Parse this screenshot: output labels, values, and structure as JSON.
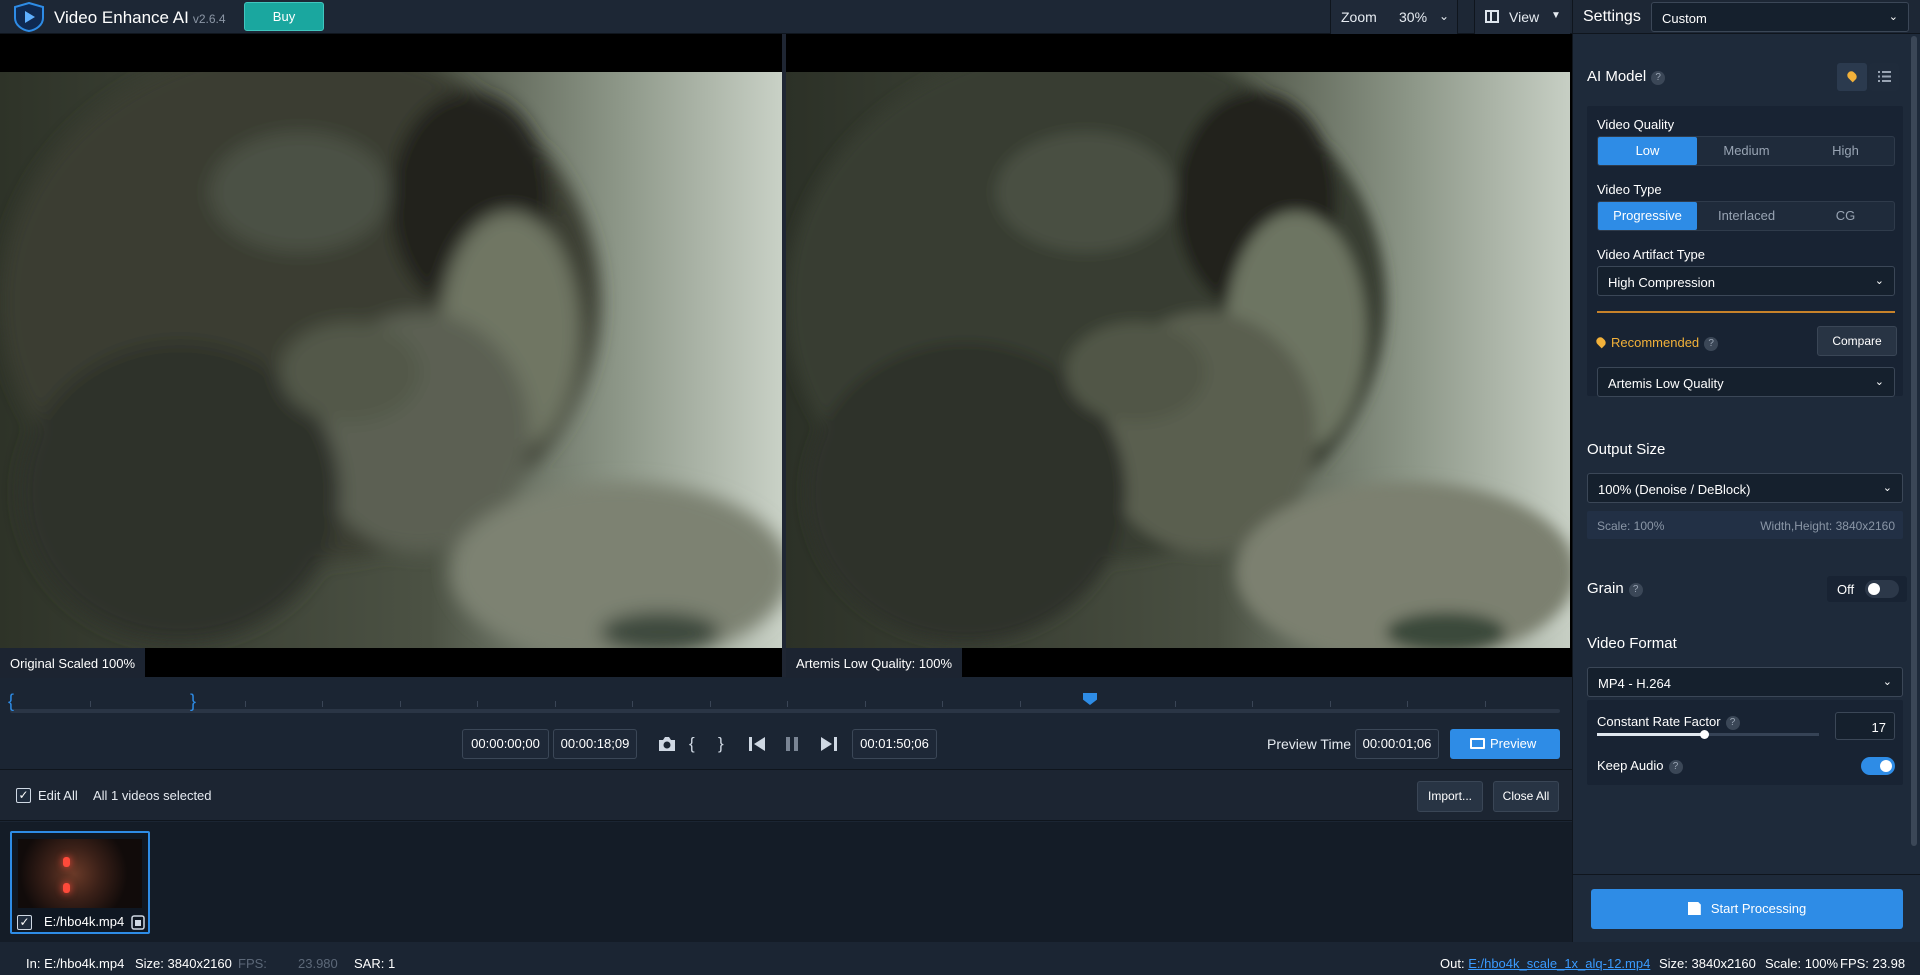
{
  "app": {
    "title": "Video Enhance AI",
    "version": "v2.6.4",
    "buy_label": "Buy"
  },
  "toolbar": {
    "zoom_label": "Zoom",
    "zoom_value": "30%",
    "view_label": "View"
  },
  "viewer": {
    "left_caption": "Original Scaled 100%",
    "right_caption": "Artemis Low Quality: 100%"
  },
  "timeline": {
    "start_time": "00:00:00;00",
    "selection_duration": "00:00:18;09",
    "total_time": "00:01:50;06",
    "preview_time_label": "Preview Time",
    "preview_time": "00:00:01;06",
    "preview_button": "Preview"
  },
  "filebar": {
    "edit_all_label": "Edit All",
    "selected_text": "All 1 videos selected",
    "import_label": "Import...",
    "close_all_label": "Close All"
  },
  "files": [
    {
      "name": "E:/hbo4k.mp4",
      "checked": true
    }
  ],
  "status": {
    "in_label": "In:",
    "in_file": "E:/hbo4k.mp4",
    "in_size_label": "Size:",
    "in_size": "3840x2160",
    "fps_label": "FPS:",
    "fps": "23.980",
    "sar_label": "SAR:",
    "sar": "1",
    "out_label": "Out:",
    "out_file": "E:/hbo4k_scale_1x_alq-12.mp4",
    "out_size_label": "Size:",
    "out_size": "3840x2160",
    "scale_label": "Scale:",
    "scale": "100%",
    "out_fps_label": "FPS:",
    "out_fps": "23.98"
  },
  "settings": {
    "title": "Settings",
    "preset": "Custom",
    "ai_model_title": "AI Model",
    "video_quality_label": "Video Quality",
    "video_quality_options": [
      "Low",
      "Medium",
      "High"
    ],
    "video_quality_selected": "Low",
    "video_type_label": "Video Type",
    "video_type_options": [
      "Progressive",
      "Interlaced",
      "CG"
    ],
    "video_type_selected": "Progressive",
    "artifact_label": "Video Artifact Type",
    "artifact_value": "High Compression",
    "recommended_label": "Recommended",
    "compare_label": "Compare",
    "model_value": "Artemis Low Quality",
    "output_size_title": "Output Size",
    "output_size_value": "100% (Denoise / DeBlock)",
    "scale_text": "Scale: 100%",
    "dimensions_text": "Width,Height: 3840x2160",
    "grain_title": "Grain",
    "grain_state": "Off",
    "grain_on": false,
    "video_format_title": "Video Format",
    "video_format_value": "MP4  - H.264",
    "crf_label": "Constant Rate Factor",
    "crf_value": "17",
    "crf_fraction": 0.48,
    "keep_audio_label": "Keep Audio",
    "keep_audio_on": true,
    "start_label": "Start Processing"
  },
  "colors": {
    "accent": "#2e8ce6",
    "buy": "#1aa79f",
    "recommended": "#f2b13a"
  }
}
